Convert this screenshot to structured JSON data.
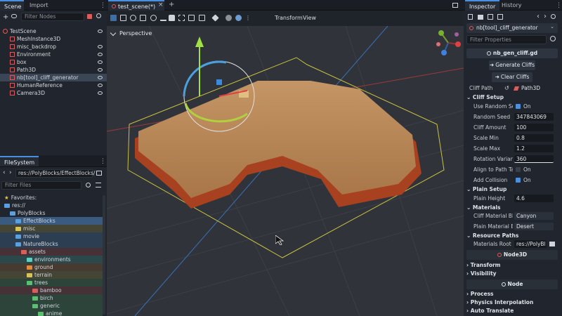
{
  "scene_dock": {
    "tabs": [
      "Scene",
      "Import"
    ],
    "filter_placeholder": "Filter Nodes",
    "tree": [
      {
        "label": "TestScene",
        "color": "#e05a5a",
        "indent": 0
      },
      {
        "label": "MeshInstance3D",
        "color": "#e05a5a",
        "indent": 1
      },
      {
        "label": "misc_backdrop",
        "color": "#e05a5a",
        "indent": 1
      },
      {
        "label": "Environment",
        "color": "#e05a5a",
        "indent": 1
      },
      {
        "label": "box",
        "color": "#e05a5a",
        "indent": 1
      },
      {
        "label": "Path3D",
        "color": "#e05a5a",
        "indent": 1
      },
      {
        "label": "nb[tool]_cliff_generator",
        "color": "#e05a5a",
        "indent": 1
      },
      {
        "label": "HumanReference",
        "color": "#e05a5a",
        "indent": 1
      },
      {
        "label": "Camera3D",
        "color": "#e05a5a",
        "indent": 1
      }
    ]
  },
  "filesystem": {
    "tab": "FileSystem",
    "path": "res://PolyBlocks/EffectBlocks/",
    "filter_placeholder": "Filter Files",
    "items": [
      {
        "label": "Favorites:",
        "indent": 0,
        "color": "#e8c34a",
        "kind": "star"
      },
      {
        "label": "res://",
        "indent": 0,
        "color": "#5aa0e0",
        "kind": "folder"
      },
      {
        "label": "PolyBlocks",
        "indent": 1,
        "color": "#5aa0e0",
        "kind": "folder"
      },
      {
        "label": "EffectBlocks",
        "indent": 2,
        "color": "#5aa0e0",
        "kind": "folder"
      },
      {
        "label": "misc",
        "indent": 2,
        "color": "#d9c356",
        "kind": "folder"
      },
      {
        "label": "movie",
        "indent": 2,
        "color": "#5aa0e0",
        "kind": "folder"
      },
      {
        "label": "NatureBlocks",
        "indent": 2,
        "color": "#5aa0e0",
        "kind": "folder"
      },
      {
        "label": "assets",
        "indent": 3,
        "color": "#d9605a",
        "kind": "folder"
      },
      {
        "label": "environments",
        "indent": 4,
        "color": "#5ad0c0",
        "kind": "folder"
      },
      {
        "label": "ground",
        "indent": 4,
        "color": "#e08a3a",
        "kind": "folder"
      },
      {
        "label": "terrain",
        "indent": 4,
        "color": "#d9c356",
        "kind": "folder"
      },
      {
        "label": "trees",
        "indent": 4,
        "color": "#5ac070",
        "kind": "folder"
      },
      {
        "label": "bamboo",
        "indent": 5,
        "color": "#d9605a",
        "kind": "folder"
      },
      {
        "label": "birch",
        "indent": 5,
        "color": "#5ac070",
        "kind": "folder"
      },
      {
        "label": "generic",
        "indent": 5,
        "color": "#5ac070",
        "kind": "folder"
      },
      {
        "label": "anime",
        "indent": 6,
        "color": "#5ac070",
        "kind": "folder"
      }
    ]
  },
  "viewport": {
    "tab_label": "test_scene(*)",
    "perspective_label": "Perspective",
    "transform_menu": "Transform",
    "view_menu": "View"
  },
  "inspector": {
    "tabs": [
      "Inspector",
      "History"
    ],
    "node_name": "nb[tool]_cliff_generator",
    "filter_placeholder": "Filter Properties",
    "script_name": "nb_gen_cliff.gd",
    "generate_button": "Generate Cliffs",
    "clear_button": "Clear Cliffs",
    "cliff_path_label": "Cliff Path",
    "cliff_path_value": "Path3D",
    "sections": {
      "cliff_setup": "Cliff Setup",
      "plain_setup": "Plain Setup",
      "materials": "Materials",
      "resource_paths": "Resource Paths",
      "transform": "Transform",
      "visibility": "Visibility",
      "process": "Process",
      "physics_interpolation": "Physics Interpolation",
      "auto_translate": "Auto Translate"
    },
    "use_random_seed": {
      "label": "Use Random See",
      "value": "On"
    },
    "random_seed": {
      "label": "Random Seed",
      "value": "347843069"
    },
    "cliff_amount": {
      "label": "Cliff Amount",
      "value": "100"
    },
    "scale_min": {
      "label": "Scale Min",
      "value": "0.8"
    },
    "scale_max": {
      "label": "Scale Max",
      "value": "1.2"
    },
    "rotation_variance": {
      "label": "Rotation Variance",
      "value": "360"
    },
    "align_to_path": {
      "label": "Align to Path Tan",
      "value": "On"
    },
    "add_collision": {
      "label": "Add Collision",
      "value": "On"
    },
    "plain_height": {
      "label": "Plain Height",
      "value": "4.6"
    },
    "cliff_material": {
      "label": "Cliff Material Blo",
      "value": "Canyon"
    },
    "plain_material": {
      "label": "Plain Material Blo",
      "value": "Desert"
    },
    "materials_root": {
      "label": "Materials Root Pa",
      "value": "res://PolyBl"
    },
    "node3d_header": "Node3D",
    "node_header": "Node"
  }
}
